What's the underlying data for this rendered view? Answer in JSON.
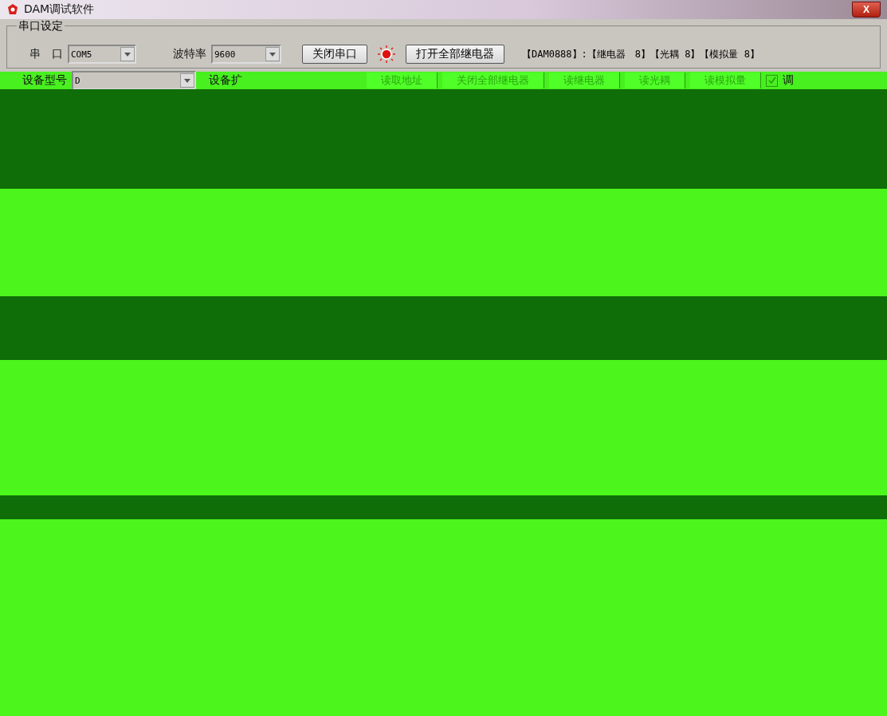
{
  "window": {
    "title": "DAM调试软件",
    "close": "X"
  },
  "serial_group": {
    "title": "串口设定",
    "port": {
      "label": "串　口",
      "value": "COM5"
    },
    "baud": {
      "label": "波特率",
      "value": "9600"
    },
    "close_port": "关闭串口",
    "led_on": true,
    "open_all": "打开全部继电器",
    "device_info": "【DAM0888】:【继电器　8】【光耦 8】【模拟量 8】"
  },
  "device_row": {
    "label": "设备型号",
    "value": "D",
    "ext_label": "设备扩",
    "buttons": [
      "读取地址",
      "关闭全部继电器",
      "读继电器",
      "读光耦",
      "读模拟量"
    ],
    "checkbox": {
      "label": "调",
      "checked": true
    }
  }
}
